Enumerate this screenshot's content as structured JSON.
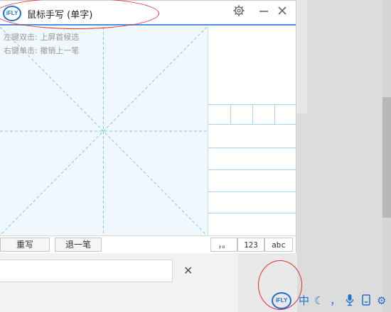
{
  "window": {
    "logo_text": "iFLY",
    "title": "鼠标手写 (单字)"
  },
  "hints": {
    "line1": "左键双击: 上屏首候选",
    "line2": "右键单击: 撤销上一笔"
  },
  "buttons": {
    "rewrite": "重写",
    "undo_stroke": "退一笔"
  },
  "modes": {
    "punct": "，。",
    "digits": "123",
    "letters": "abc"
  },
  "below": {
    "close_glyph": "✕"
  },
  "tray": {
    "logo_text": "iFLY",
    "chinese": "中",
    "moon": "☾",
    "punct": "，",
    "mic": "🎤",
    "doc": "▯",
    "gear": "⚙"
  },
  "colors": {
    "accent": "#1e6fd0",
    "guide": "#7ec8e8",
    "highlight": "#e03030"
  }
}
